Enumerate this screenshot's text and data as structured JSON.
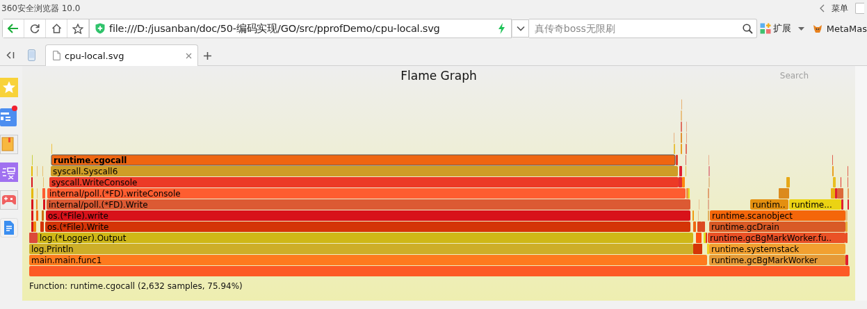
{
  "browser": {
    "title": "360安全浏览器 10.0",
    "menu_label": "菜单",
    "address": "file:///D:/jusanban/doc/50-编码实现/GO/src/pprofDemo/cpu-local.svg",
    "search_placeholder": "真传奇boss无限刷",
    "extensions_label": "扩展",
    "extension_name": "MetaMas"
  },
  "tabs": [
    {
      "label": "cpu-local.svg",
      "selected": true
    }
  ],
  "page": {
    "title": "Flame Graph",
    "search": "Search",
    "frames": [
      {
        "label": "runtime.cgocall",
        "color": "#ef6611",
        "selected": true
      },
      {
        "label": "syscall.Syscall6",
        "color": "#cf9d27",
        "selected": false
      },
      {
        "label": "syscall.WriteConsole",
        "color": "#ec3a26",
        "selected": false
      },
      {
        "label": "internal/poll.(*FD).writeConsole",
        "color": "#fe5d30",
        "selected": false
      },
      {
        "label": "internal/poll.(*FD).Write",
        "color": "#dc5a33",
        "selected": false
      },
      {
        "label": "runtim..",
        "color": "#e49010",
        "selected": false
      },
      {
        "label": "runtime...",
        "color": "#ebd313",
        "selected": false
      },
      {
        "label": "os.(*File).write",
        "color": "#d8121a",
        "selected": false
      },
      {
        "label": "runtime.scanobject",
        "color": "#f4660a",
        "selected": false
      },
      {
        "label": "os.(*File).Write",
        "color": "#d43407",
        "selected": false
      },
      {
        "label": "runtime.gcDrain",
        "color": "#d95a26",
        "selected": false
      },
      {
        "label": "log.(*Logger).Output",
        "color": "#cfb717",
        "selected": false
      },
      {
        "label": "runtime.gcBgMarkWorker.fu..",
        "color": "#ea5126",
        "selected": false
      },
      {
        "label": "log.Println",
        "color": "#cdae28",
        "selected": false
      },
      {
        "label": "runtime.systemstack",
        "color": "#f2a030",
        "selected": false
      },
      {
        "label": "main.main.func1",
        "color": "#fe7a1e",
        "selected": false
      },
      {
        "label": "runtime.gcBgMarkWorker",
        "color": "#e69a37",
        "selected": false
      }
    ],
    "details": "Function: runtime.cgocall (2,632 samples, 75.94%)"
  }
}
